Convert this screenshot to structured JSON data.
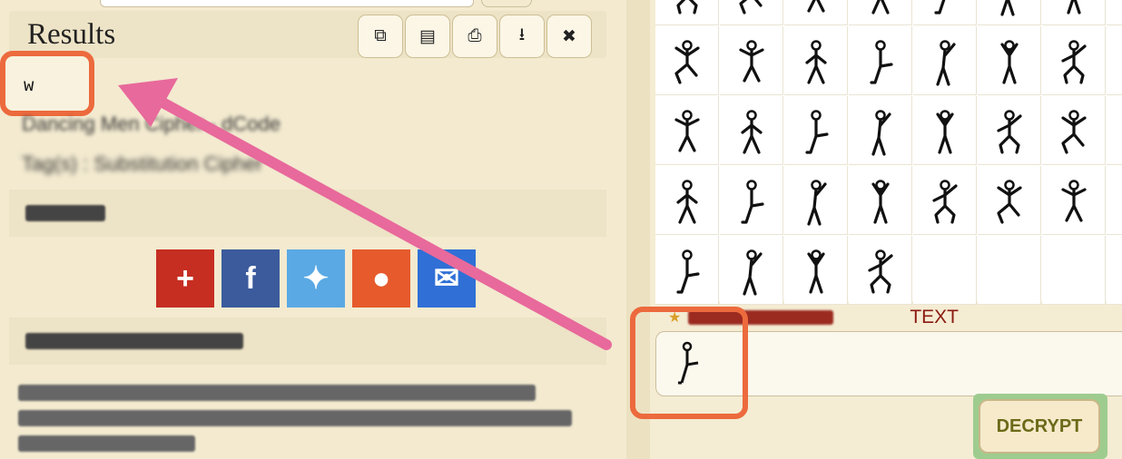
{
  "results": {
    "title": "Results",
    "value": "w",
    "toolbar": [
      {
        "name": "copy-button",
        "icon": "copy-icon",
        "glyph": "⧉"
      },
      {
        "name": "save-button",
        "icon": "floppy-icon",
        "glyph": "▤"
      },
      {
        "name": "print-button",
        "icon": "printer-icon",
        "glyph": "⎙"
      },
      {
        "name": "download-button",
        "icon": "download-icon",
        "glyph": "⭳"
      },
      {
        "name": "close-button",
        "icon": "close-icon",
        "glyph": "✖"
      }
    ],
    "source_line": "Dancing Men Cipher - dCode",
    "tag_line": "Tag(s) : Substitution Cipher"
  },
  "cipher_panel": {
    "label": "TEXT",
    "decrypt_label": "DECRYPT"
  },
  "colors": {
    "highlight": "#ec6a3d",
    "arrow": "#e8699b",
    "decrypt_border": "#9ecc8f"
  }
}
